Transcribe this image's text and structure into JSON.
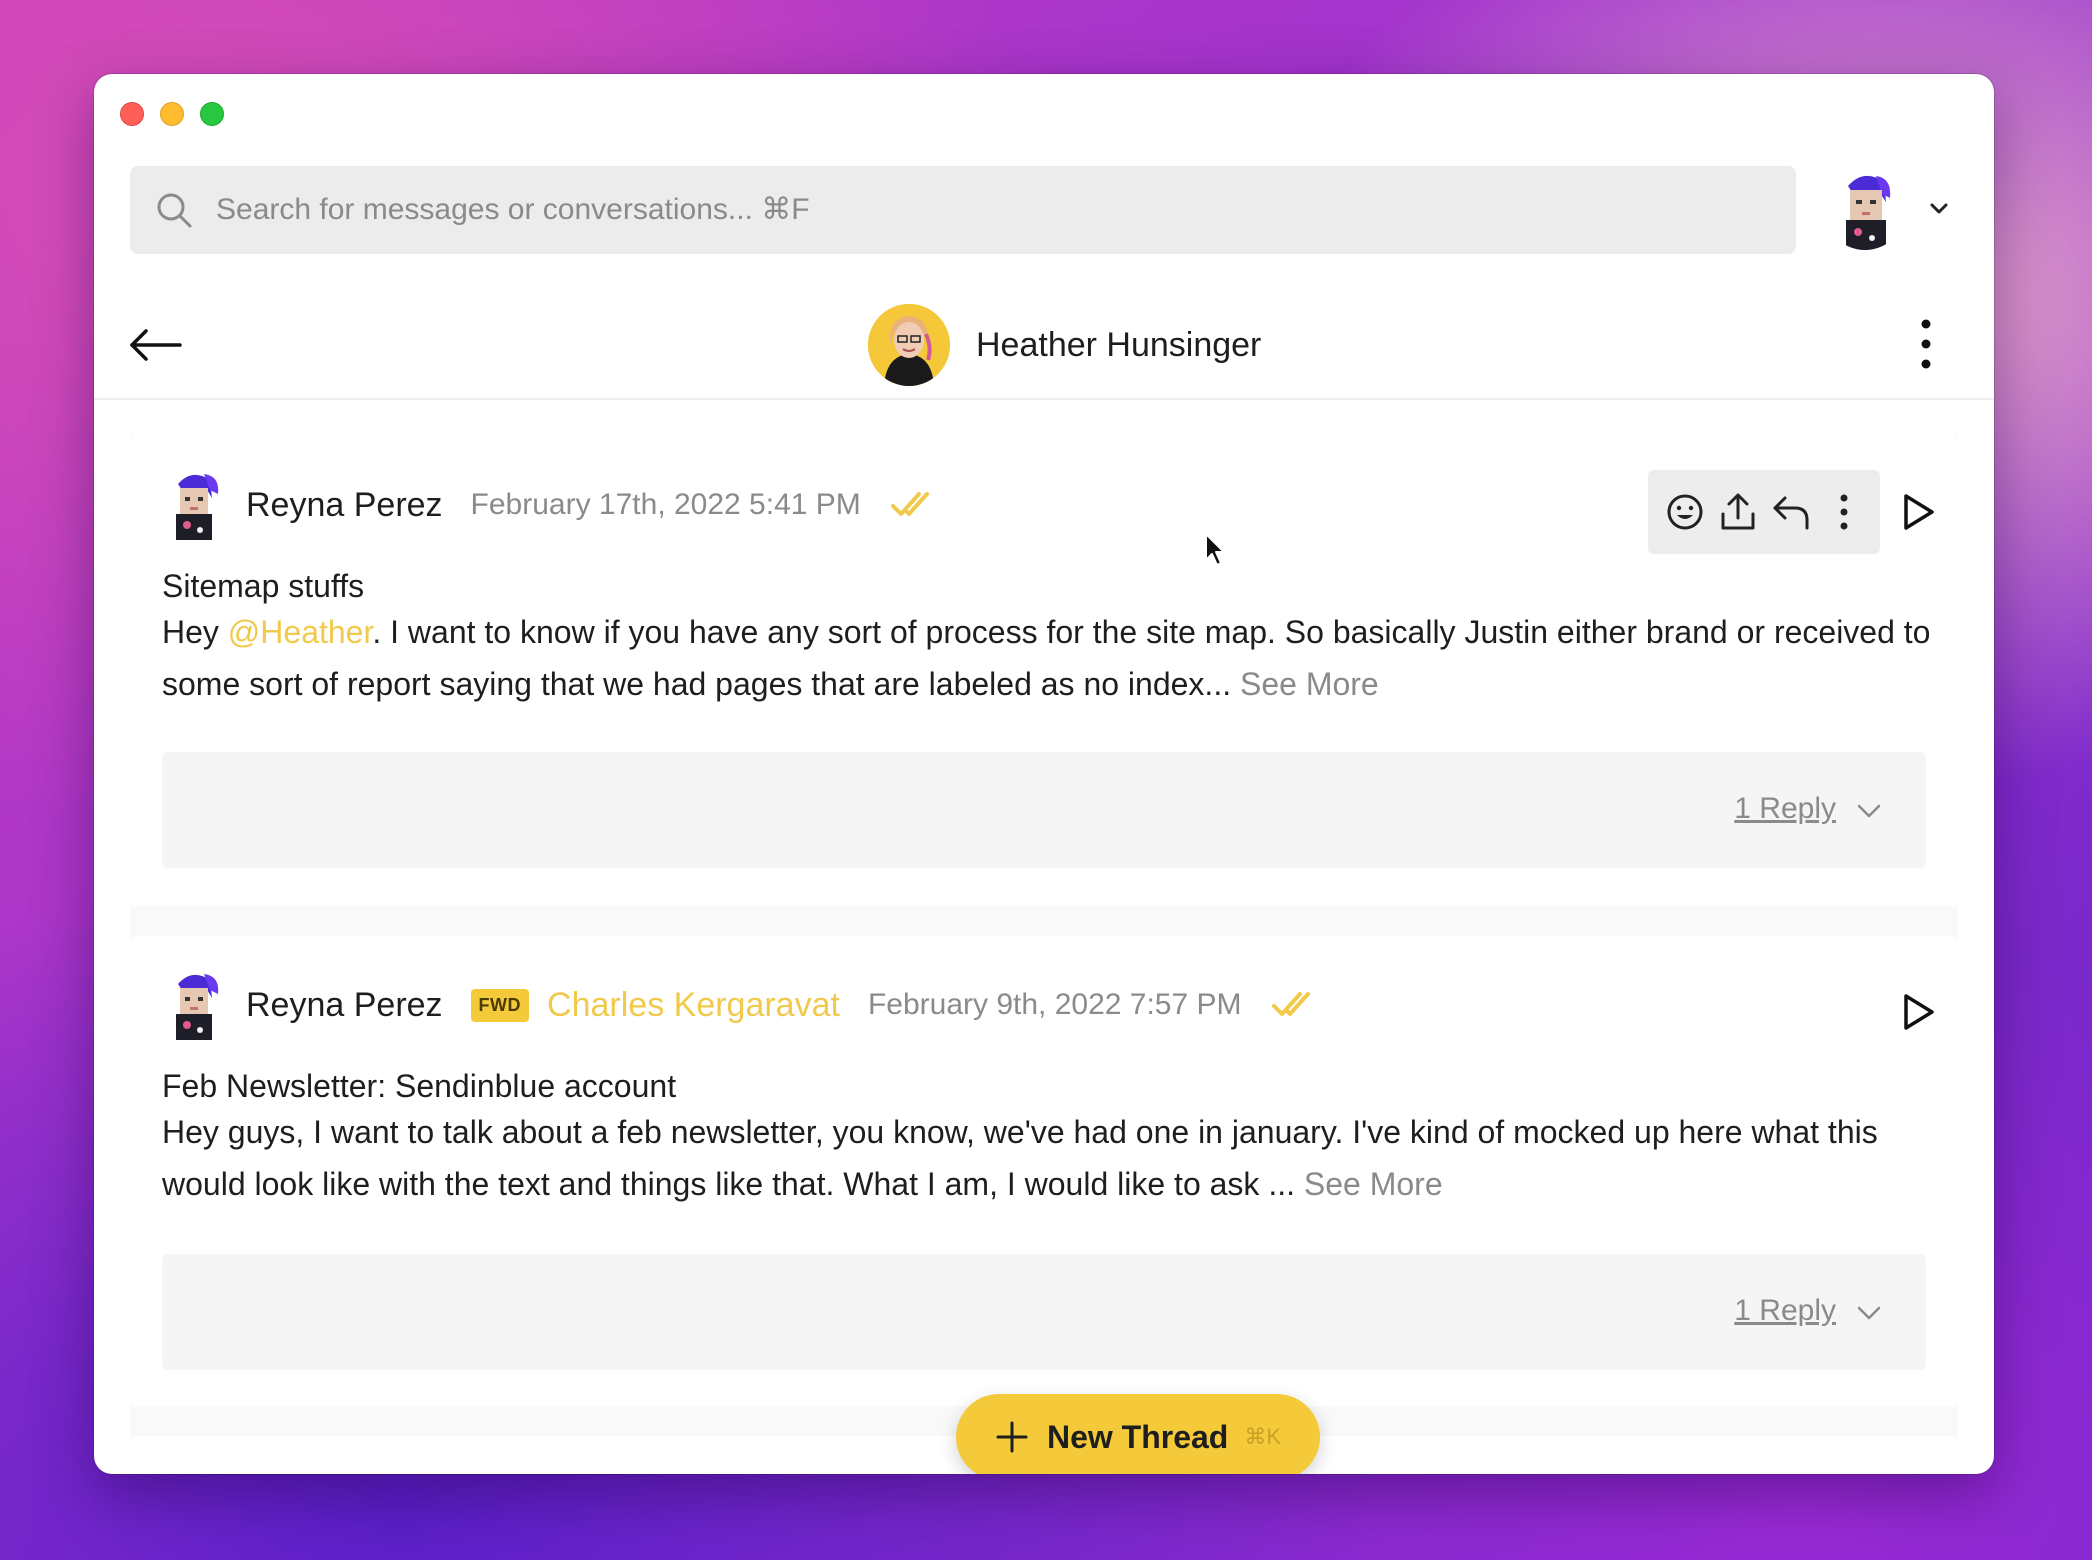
{
  "search": {
    "placeholder": "Search for messages or conversations... ⌘F"
  },
  "header": {
    "contact_name": "Heather Hunsinger"
  },
  "messages": [
    {
      "sender": "Reyna Perez",
      "timestamp": "February 17th, 2022 5:41 PM",
      "subject": "Sitemap stuffs",
      "body_prefix": "Hey ",
      "mention": "@Heather",
      "body": ". I want to know if you have any sort of process for the site map. So basically Justin either brand or received to some sort of report saying that we had pages that are labeled as no index...",
      "see_more": "See More",
      "replies": "1 Reply"
    },
    {
      "sender": "Reyna Perez",
      "badge": "FWD",
      "forwarded_from": "Charles Kergaravat",
      "timestamp": "February 9th, 2022 7:57 PM",
      "subject": "Feb Newsletter: Sendinblue account",
      "body": "Hey guys, I want to talk about a feb newsletter, you know, we've had one in january. I've kind of mocked up here what this would look like with the text and things like that. What I am, I would like to ask ...",
      "see_more": "See More",
      "replies": "1 Reply"
    }
  ],
  "new_thread": {
    "label": "New Thread",
    "shortcut": "⌘K"
  },
  "icons": {
    "read_check_color": "#f1c94b",
    "accent": "#f4c93a"
  }
}
